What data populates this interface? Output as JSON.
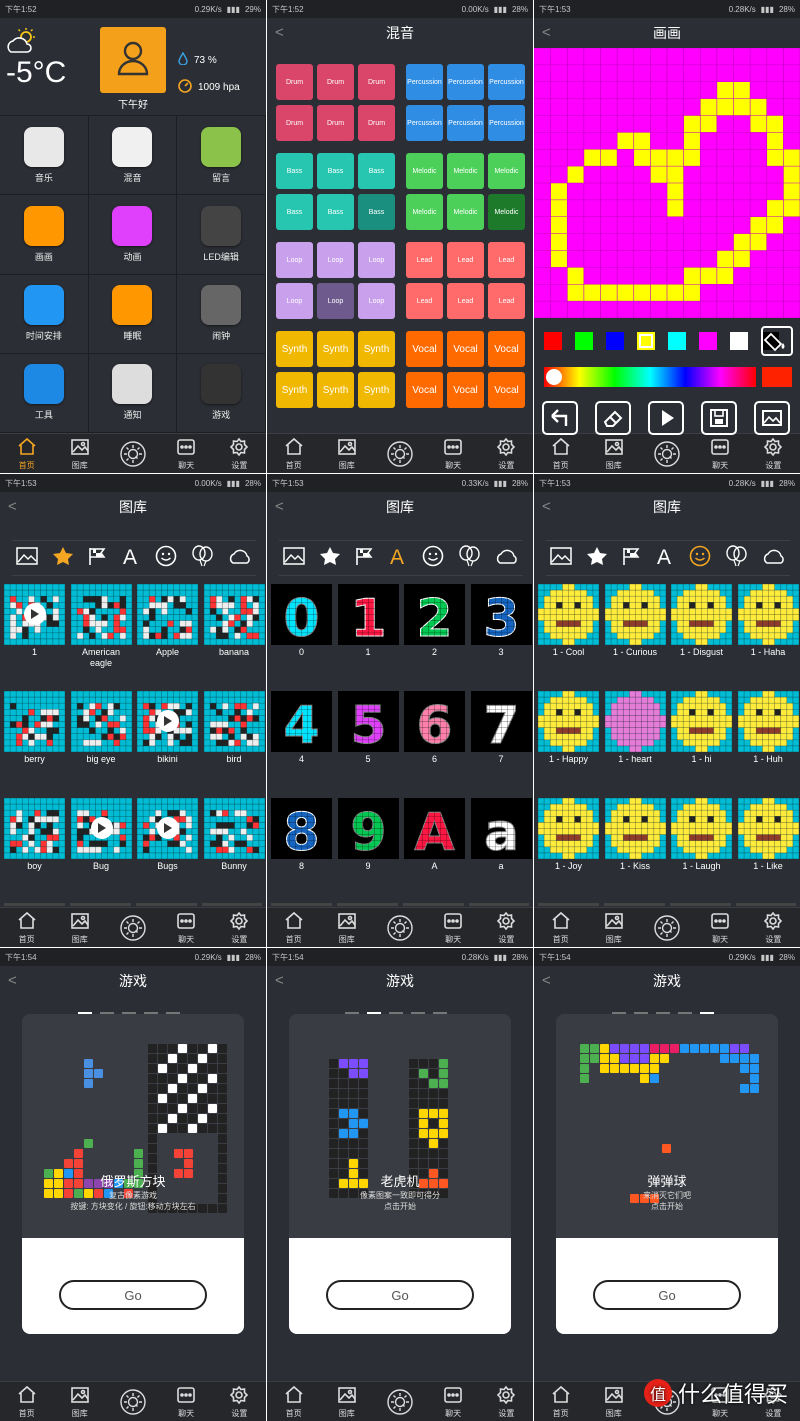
{
  "status": [
    {
      "time": "下午1:52",
      "speed": "0.29K/s",
      "battery": "29%"
    },
    {
      "time": "下午1:52",
      "speed": "0.00K/s",
      "battery": "28%"
    },
    {
      "time": "下午1:53",
      "speed": "0.28K/s",
      "battery": "28%"
    },
    {
      "time": "下午1:53",
      "speed": "0.00K/s",
      "battery": "28%"
    },
    {
      "time": "下午1:53",
      "speed": "0.33K/s",
      "battery": "28%"
    },
    {
      "time": "下午1:53",
      "speed": "0.28K/s",
      "battery": "28%"
    },
    {
      "time": "下午1:54",
      "speed": "0.29K/s",
      "battery": "28%"
    },
    {
      "time": "下午1:54",
      "speed": "0.28K/s",
      "battery": "28%"
    },
    {
      "time": "下午1:54",
      "speed": "0.29K/s",
      "battery": "28%"
    }
  ],
  "nav": [
    "首页",
    "图库",
    "",
    "聊天",
    "设置"
  ],
  "home": {
    "temperature": "-5°C",
    "greeting": "下午好",
    "humidity": "73 %",
    "pressure": "1009 hpa",
    "apps": [
      {
        "label": "音乐",
        "icon": "music-icon",
        "color": "#e8e8e8"
      },
      {
        "label": "混音",
        "icon": "mixer-icon",
        "color": "#f0f0f0"
      },
      {
        "label": "留言",
        "icon": "microphone-icon",
        "color": "#8bc34a"
      },
      {
        "label": "画画",
        "icon": "palette-icon",
        "color": "#ff9800"
      },
      {
        "label": "动画",
        "icon": "runner-icon",
        "color": "#e040fb"
      },
      {
        "label": "LED编辑",
        "icon": "led-icon",
        "color": "#444"
      },
      {
        "label": "时间安排",
        "icon": "calendar-icon",
        "color": "#2196f3"
      },
      {
        "label": "睡眠",
        "icon": "sleep-icon",
        "color": "#ff9800"
      },
      {
        "label": "闹钟",
        "icon": "clock-icon",
        "color": "#666"
      },
      {
        "label": "工具",
        "icon": "toolbox-icon",
        "color": "#1e88e5"
      },
      {
        "label": "通知",
        "icon": "bell-icon",
        "color": "#ddd"
      },
      {
        "label": "游戏",
        "icon": "game-icon",
        "color": "#333"
      }
    ]
  },
  "mixer": {
    "title": "混音",
    "groups": [
      {
        "label": "Drum",
        "color": "#d9466a"
      },
      {
        "label": "Percussion",
        "color": "#2f8de4"
      },
      {
        "label": "Bass",
        "color": "#26c6b0"
      },
      {
        "label": "Melodic",
        "color": "#4cd05a"
      },
      {
        "label": "Loop",
        "color": "#c9a0ec"
      },
      {
        "label": "Lead",
        "color": "#ff6b6b"
      },
      {
        "label": "Synth",
        "color": "#f0b800"
      },
      {
        "label": "Vocal",
        "color": "#ff6a00"
      }
    ]
  },
  "draw": {
    "title": "画画",
    "swatches": [
      "#ff0000",
      "#00ff00",
      "#0000ff",
      "#ffff00",
      "#00ffff",
      "#ff00ff",
      "#ffffff",
      "#000000"
    ]
  },
  "library": [
    {
      "title": "图库",
      "items": [
        "1",
        "American eagle",
        "Apple",
        "banana",
        "berry",
        "big eye",
        "bikini",
        "bird",
        "boy",
        "Bug",
        "Bugs",
        "Bunny"
      ]
    },
    {
      "title": "图库",
      "items": [
        "0",
        "1",
        "2",
        "3",
        "4",
        "5",
        "6",
        "7",
        "8",
        "9",
        "A",
        "a"
      ]
    },
    {
      "title": "图库",
      "items": [
        "1 - Cool",
        "1 - Curious",
        "1 - Disgust",
        "1 - Haha",
        "1 - Happy",
        "1 - heart",
        "1 - hi",
        "1 - Huh",
        "1 - Joy",
        "1 - Kiss",
        "1 - Laugh",
        "1 - Like"
      ]
    }
  ],
  "games": {
    "title": "游戏",
    "go": "Go",
    "cards": [
      {
        "name": "俄罗斯方块",
        "line1": "复古像素游戏",
        "line2": "按键: 方块变化 / 旋钮:移动方块左右"
      },
      {
        "name": "老虎机",
        "line1": "像素图案一致即可得分",
        "line2": "点击开始"
      },
      {
        "name": "弹弹球",
        "line1": "来消灭它们吧",
        "line2": "点击开始"
      }
    ]
  },
  "watermark": "值 什么值得买"
}
